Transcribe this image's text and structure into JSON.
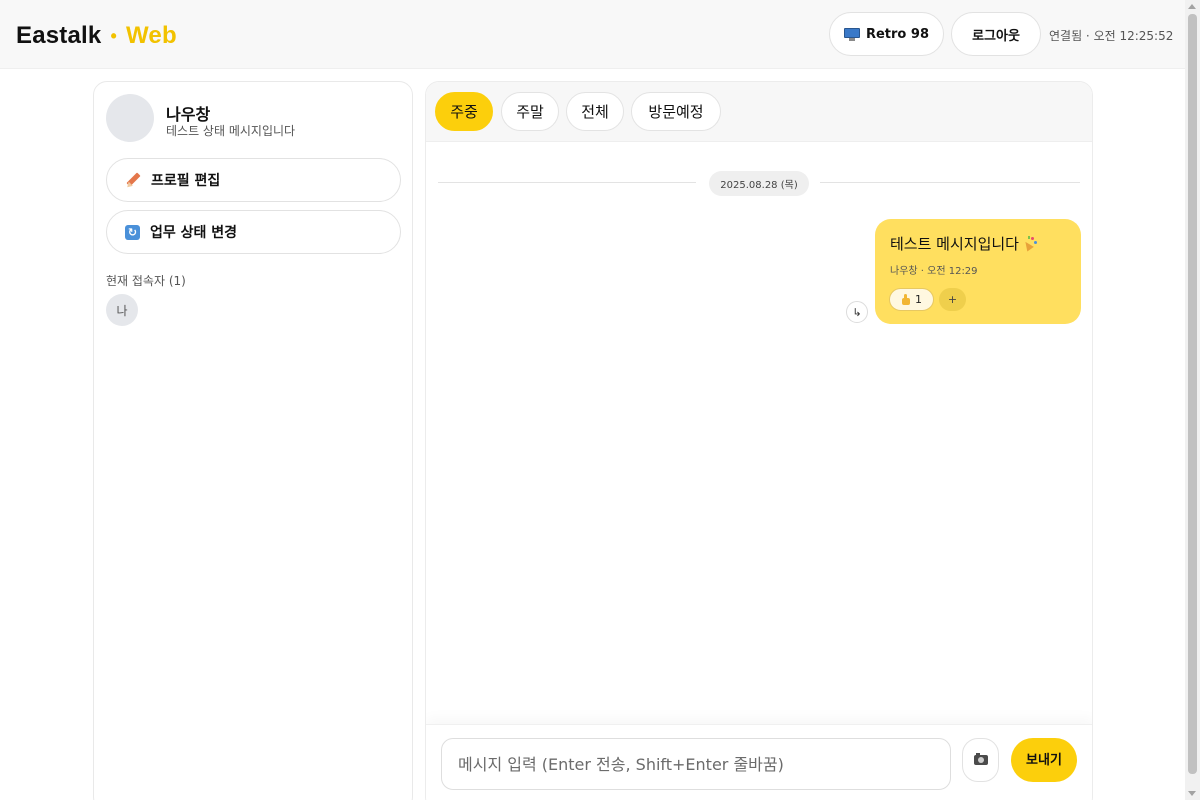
{
  "header": {
    "brand_main": "Eastalk",
    "brand_dot": "•",
    "brand_sub": "Web",
    "retro_button": "Retro 98",
    "logout_button": "로그아웃",
    "status": "연결됨 · 오전 12:25:52"
  },
  "profile": {
    "name": "나우창",
    "status_message": "테스트 상태 메시지입니다",
    "edit_profile": "프로필 편집",
    "change_state": "업무 상태 변경",
    "online_label": "현재 접속자 (1)",
    "online_users": [
      "나"
    ]
  },
  "chat": {
    "tabs": [
      {
        "label": "주중",
        "active": true
      },
      {
        "label": "주말",
        "active": false
      },
      {
        "label": "전체",
        "active": false
      },
      {
        "label": "방문예정",
        "active": false
      }
    ],
    "date_divider": "2025.08.28 (목)",
    "messages": [
      {
        "text": "테스트 메시지입니다",
        "meta": "나우창 · 오전 12:29",
        "reaction_count": "1",
        "add_reaction": "+",
        "reply_icon": "↳"
      }
    ]
  },
  "composer": {
    "placeholder": "메시지 입력 (Enter 전송, Shift+Enter 줄바꿈)",
    "value": "",
    "send_button": "보내기"
  },
  "icons": {
    "retro": "monitor-icon",
    "edit": "pencil-icon",
    "change_state": "refresh-icon",
    "message_emoji": "party-popper-icon",
    "reaction": "thumbs-up-icon",
    "attach": "camera-icon"
  },
  "colors": {
    "accent": "#fccf0c",
    "bubble": "#ffdf5f",
    "header_bg": "#f8f8f8"
  }
}
